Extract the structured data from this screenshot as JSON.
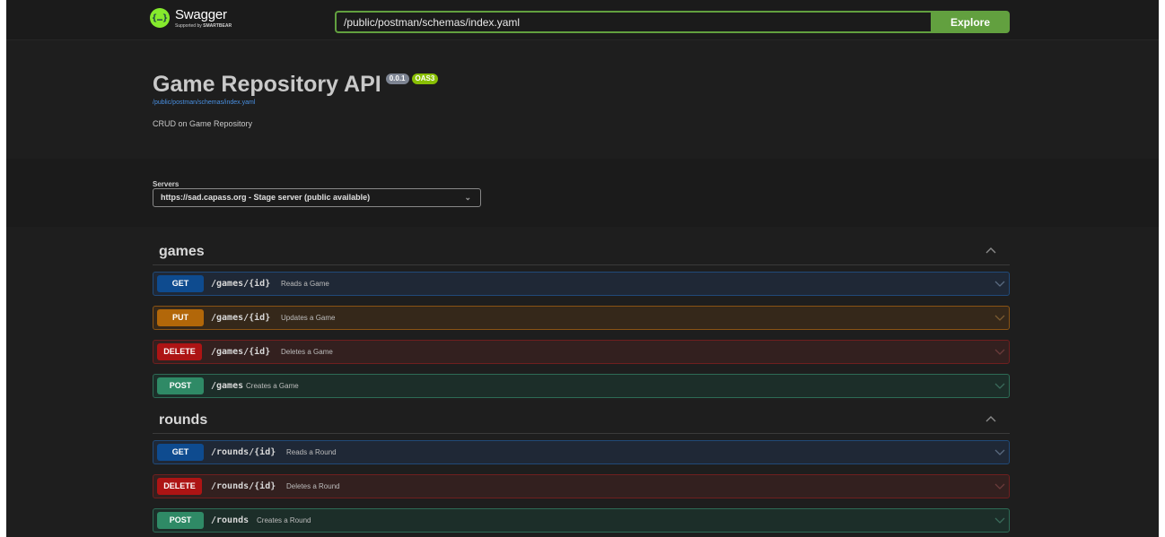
{
  "topbar": {
    "logo_name": "Swagger",
    "logo_sub_prefix": "Supported by",
    "logo_sub_brand": "SMARTBEAR",
    "url_value": "/public/postman/schemas/index.yaml",
    "explore_label": "Explore"
  },
  "info": {
    "title": "Game Repository API",
    "version": "0.0.1",
    "oas": "OAS3",
    "spec_link": "/public/postman/schemas/index.yaml",
    "description": "CRUD on Game Repository"
  },
  "servers": {
    "label": "Servers",
    "selected": "https://sad.capass.org - Stage server (public available)"
  },
  "tags": [
    {
      "name": "games",
      "operations": [
        {
          "method": "GET",
          "path": "/games/{id}",
          "summary": "Reads a Game"
        },
        {
          "method": "PUT",
          "path": "/games/{id}",
          "summary": "Updates a Game"
        },
        {
          "method": "DELETE",
          "path": "/games/{id}",
          "summary": "Deletes a Game"
        },
        {
          "method": "POST",
          "path": "/games",
          "summary": "Creates a Game"
        }
      ]
    },
    {
      "name": "rounds",
      "operations": [
        {
          "method": "GET",
          "path": "/rounds/{id}",
          "summary": "Reads a Round"
        },
        {
          "method": "DELETE",
          "path": "/rounds/{id}",
          "summary": "Deletes a Round"
        },
        {
          "method": "POST",
          "path": "/rounds",
          "summary": "Creates a Round"
        }
      ]
    }
  ],
  "colors": {
    "accent": "#62a03f",
    "get": "#0e4b8f",
    "put": "#b26709",
    "delete": "#ad1414",
    "post": "#2f8a66"
  }
}
